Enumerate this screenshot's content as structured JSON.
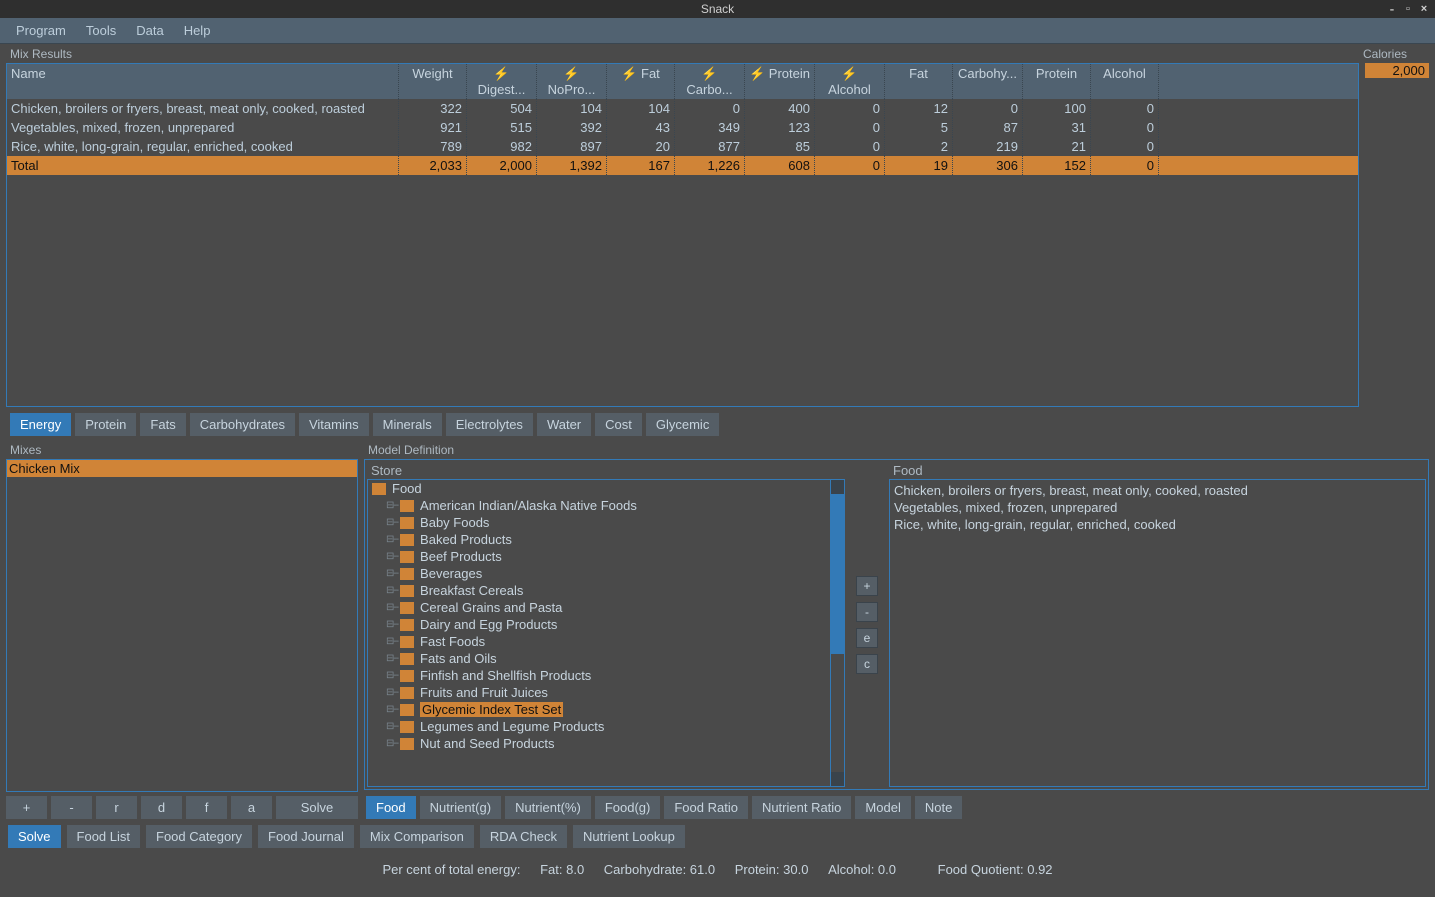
{
  "window": {
    "title": "Snack"
  },
  "menu": [
    "Program",
    "Tools",
    "Data",
    "Help"
  ],
  "mix_results_label": "Mix Results",
  "calories_label": "Calories",
  "calories_value": "2,000",
  "table": {
    "headers": [
      "Name",
      "Weight",
      "⚡ Digest...",
      "⚡ NoPro...",
      "⚡ Fat",
      "⚡ Carbo...",
      "⚡ Protein",
      "⚡ Alcohol",
      "Fat",
      "Carbohy...",
      "Protein",
      "Alcohol"
    ],
    "rows": [
      [
        "Chicken, broilers or fryers, breast, meat only, cooked, roasted",
        "322",
        "504",
        "104",
        "104",
        "0",
        "400",
        "0",
        "12",
        "0",
        "100",
        "0"
      ],
      [
        "Vegetables, mixed, frozen, unprepared",
        "921",
        "515",
        "392",
        "43",
        "349",
        "123",
        "0",
        "5",
        "87",
        "31",
        "0"
      ],
      [
        "Rice, white, long-grain, regular, enriched, cooked",
        "789",
        "982",
        "897",
        "20",
        "877",
        "85",
        "0",
        "2",
        "219",
        "21",
        "0"
      ]
    ],
    "total": [
      "Total",
      "2,033",
      "2,000",
      "1,392",
      "167",
      "1,226",
      "608",
      "0",
      "19",
      "306",
      "152",
      "0"
    ]
  },
  "nutrient_tabs": [
    "Energy",
    "Protein",
    "Fats",
    "Carbohydrates",
    "Vitamins",
    "Minerals",
    "Electrolytes",
    "Water",
    "Cost",
    "Glycemic"
  ],
  "mixes_label": "Mixes",
  "mixes": [
    "Chicken Mix"
  ],
  "mixes_btns": [
    "+",
    "-",
    "r",
    "d",
    "f",
    "a",
    "Solve"
  ],
  "model_label": "Model Definition",
  "store_label": "Store",
  "tree_root": "Food",
  "tree_items": [
    "American Indian/Alaska Native Foods",
    "Baby Foods",
    "Baked Products",
    "Beef Products",
    "Beverages",
    "Breakfast Cereals",
    "Cereal Grains and Pasta",
    "Dairy and Egg Products",
    "Fast Foods",
    "Fats and Oils",
    "Finfish and Shellfish Products",
    "Fruits and Fruit Juices",
    "Glycemic Index Test Set",
    "Legumes and Legume Products",
    "Nut and Seed Products"
  ],
  "tree_selected_index": 12,
  "mid_btns": [
    "+",
    "-",
    "e",
    "c"
  ],
  "food_label": "Food",
  "food_list": [
    "Chicken, broilers or fryers, breast, meat only, cooked, roasted",
    "Vegetables, mixed, frozen, unprepared",
    "Rice, white, long-grain, regular, enriched, cooked"
  ],
  "model_tabs": [
    "Food",
    "Nutrient(g)",
    "Nutrient(%)",
    "Food(g)",
    "Food Ratio",
    "Nutrient Ratio",
    "Model",
    "Note"
  ],
  "bottom_tabs": [
    "Solve",
    "Food List",
    "Food Category",
    "Food Journal",
    "Mix Comparison",
    "RDA Check",
    "Nutrient Lookup"
  ],
  "status": {
    "label": "Per cent of total energy:",
    "fat": "Fat: 8.0",
    "carb": "Carbohydrate: 61.0",
    "prot": "Protein: 30.0",
    "alc": "Alcohol: 0.0",
    "fq": "Food Quotient: 0.92"
  }
}
